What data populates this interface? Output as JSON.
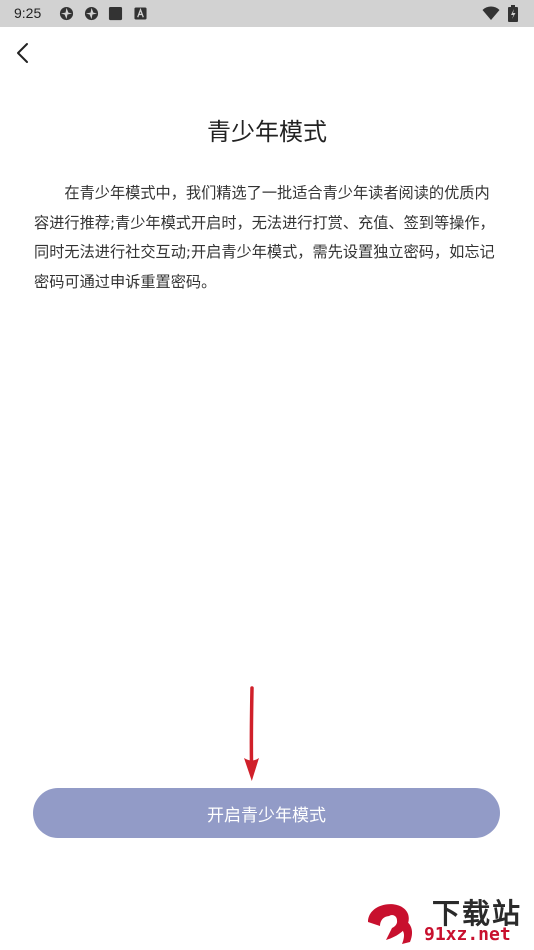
{
  "status_bar": {
    "time": "9:25",
    "icons": [
      "shutter-icon",
      "shutter-icon",
      "stop-icon",
      "a-icon",
      "wifi-icon",
      "battery-icon"
    ]
  },
  "header": {
    "back_icon": "chevron-left-icon",
    "title": "青少年模式"
  },
  "main": {
    "description": "在青少年模式中，我们精选了一批适合青少年读者阅读的优质内容进行推荐;青少年模式开启时，无法进行打赏、充值、签到等操作，同时无法进行社交互动;开启青少年模式，需先设置独立密码，如忘记密码可通过申诉重置密码。",
    "enable_button_label": "开启青少年模式"
  },
  "watermark": {
    "logo_text": "9f",
    "title": "下载站",
    "url": "91xz.net"
  },
  "colors": {
    "status_bar": "#d2d2d2",
    "button": "#929bc7",
    "arrow": "#d0202a",
    "watermark_red": "#c8102e"
  }
}
